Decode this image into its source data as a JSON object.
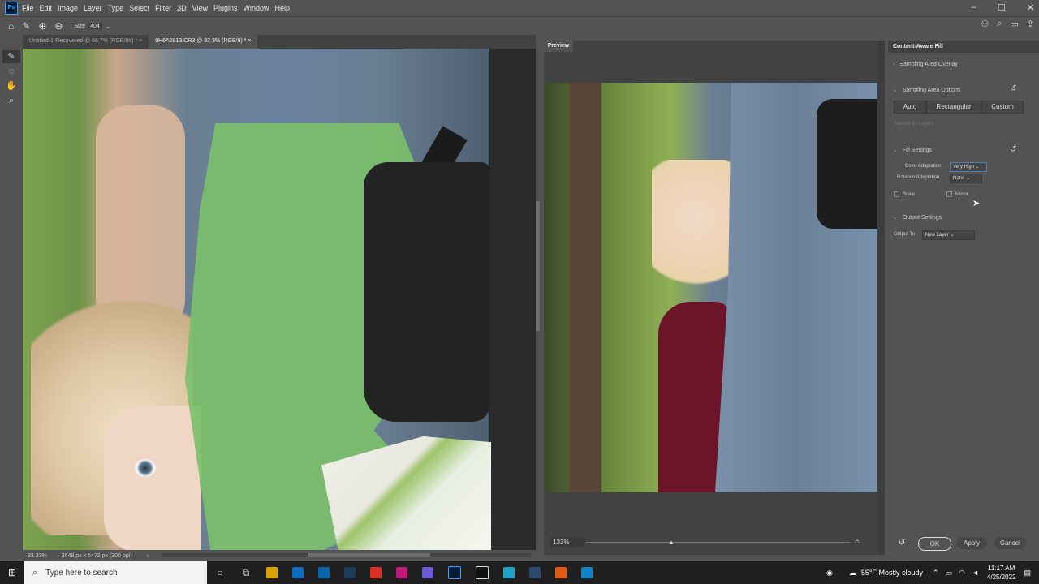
{
  "menubar": {
    "logo": "Ps",
    "items": [
      "File",
      "Edit",
      "Image",
      "Layer",
      "Type",
      "Select",
      "Filter",
      "3D",
      "View",
      "Plugins",
      "Window",
      "Help"
    ]
  },
  "options": {
    "size_label": "Size",
    "size_value": "404"
  },
  "tabs": [
    {
      "label": "Untitled-1-Recovered @ 66.7% (RGB/8#) *"
    },
    {
      "label": "0H6A2813.CR3 @ 33.3% (RGB/8) *"
    }
  ],
  "status": {
    "zoom": "33.33%",
    "doc_info": "3648 px x 5472 px (300 ppi)"
  },
  "preview": {
    "tab_label": "Preview",
    "zoom": "133%"
  },
  "caf": {
    "title": "Content-Aware Fill",
    "sampling_overlay": "Sampling Area Overlay",
    "sampling_options": "Sampling Area Options",
    "modes": [
      "Auto",
      "Rectangular",
      "Custom"
    ],
    "sample_all_layers": "Sample All Layers",
    "fill_settings": "Fill Settings",
    "color_adaptation_label": "Color Adaptation",
    "color_adaptation_value": "Very High",
    "rotation_adaptation_label": "Rotation Adaptation",
    "rotation_adaptation_value": "None",
    "scale_label": "Scale",
    "mirror_label": "Mirror",
    "output_settings": "Output Settings",
    "output_to_label": "Output To",
    "output_to_value": "New Layer",
    "ok": "OK",
    "apply": "Apply",
    "cancel": "Cancel"
  },
  "taskbar": {
    "search_placeholder": "Type here to search",
    "weather": "55°F  Mostly cloudy",
    "time": "11:17 AM",
    "date": "4/25/2022"
  }
}
